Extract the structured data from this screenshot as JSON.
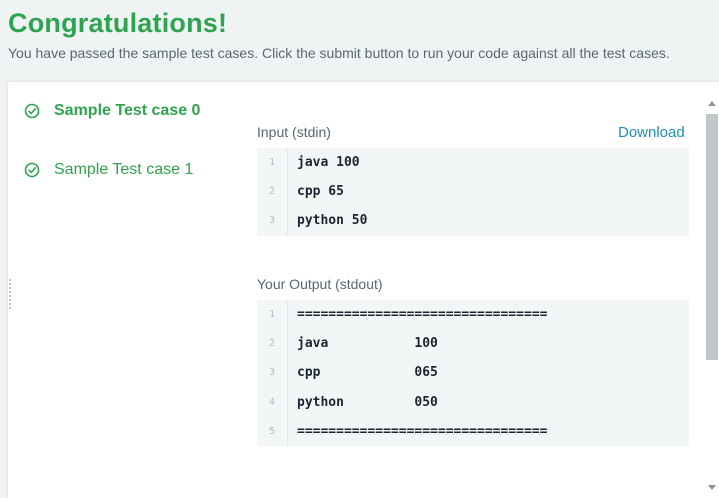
{
  "header": {
    "title": "Congratulations!",
    "subtitle": "You have passed the sample test cases. Click the submit button to run your code against all the test cases."
  },
  "test_cases": [
    {
      "label": "Sample Test case 0",
      "active": true
    },
    {
      "label": "Sample Test case 1",
      "active": false
    }
  ],
  "input": {
    "label": "Input (stdin)",
    "download": "Download",
    "lines": [
      {
        "num": "1",
        "text": "java 100"
      },
      {
        "num": "2",
        "text": "cpp 65"
      },
      {
        "num": "3",
        "text": "python 50"
      }
    ]
  },
  "output": {
    "label": "Your Output (stdout)",
    "lines": [
      {
        "num": "1",
        "text": "================================"
      },
      {
        "num": "2",
        "text": "java           100"
      },
      {
        "num": "3",
        "text": "cpp            065"
      },
      {
        "num": "4",
        "text": "python         050"
      },
      {
        "num": "5",
        "text": "================================"
      }
    ]
  },
  "colors": {
    "success": "#2ea44f",
    "link": "#1d8fb8"
  }
}
